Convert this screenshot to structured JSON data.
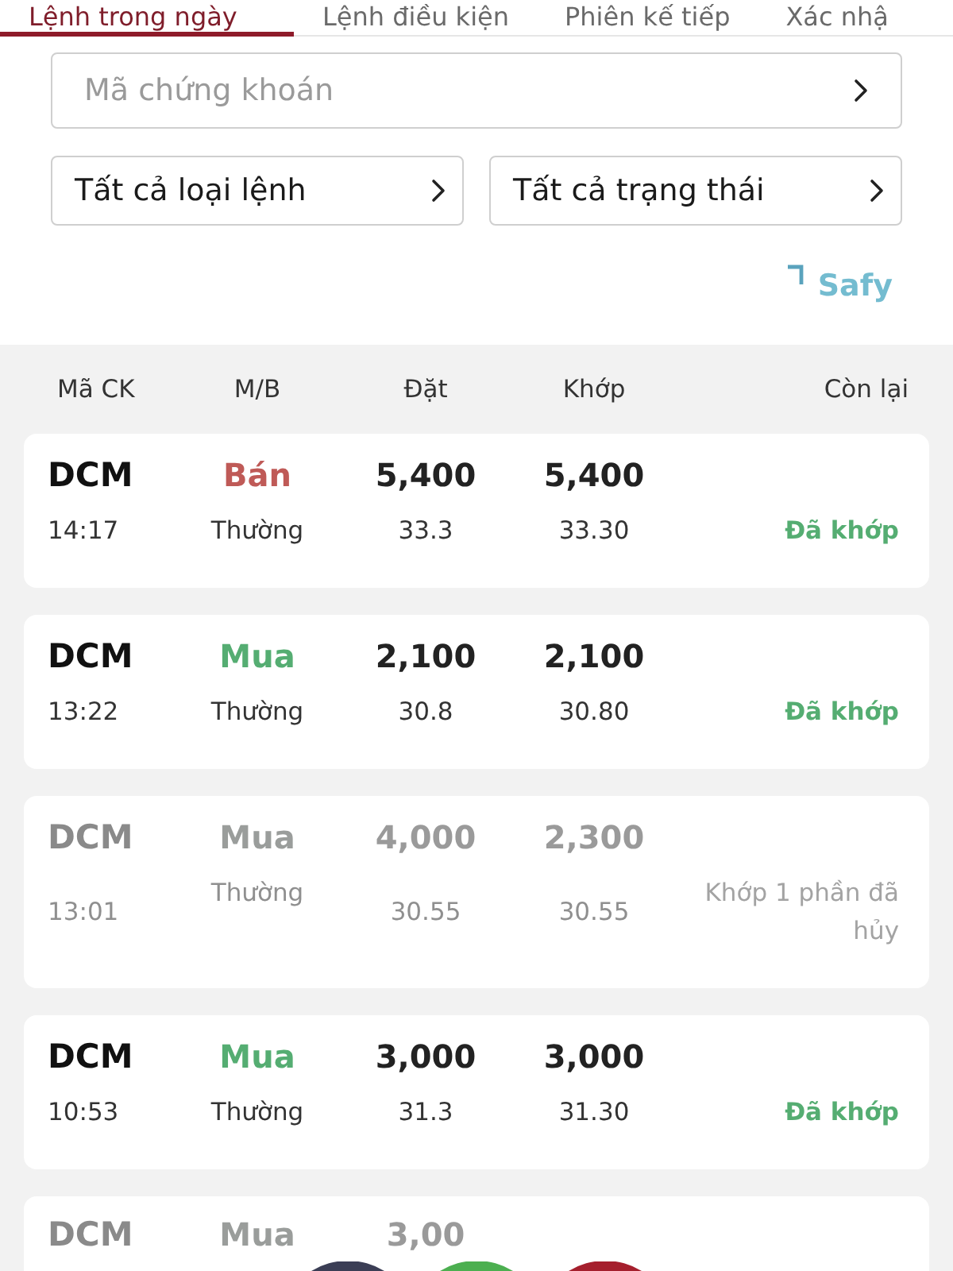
{
  "tabs": [
    {
      "label": "Lệnh trong ngày",
      "selected": true
    },
    {
      "label": "Lệnh điều kiện",
      "selected": false
    },
    {
      "label": "Phiên kế tiếp",
      "selected": false
    },
    {
      "label": "Xác nhậ",
      "selected": false
    }
  ],
  "filters": {
    "symbol": {
      "placeholder": "Mã chứng khoán"
    },
    "dropdowns": [
      {
        "value": "Tất cả loại lệnh"
      },
      {
        "value": "Tất cả trạng thái"
      }
    ]
  },
  "brand": {
    "name": "Safy"
  },
  "table": {
    "columns": [
      "Mã CK",
      "M/B",
      "Đặt",
      "Khớp",
      "Còn lại"
    ],
    "rows": [
      {
        "kind": "sell",
        "symbol": "DCM",
        "side": "Bán",
        "order_qty": "5,400",
        "matched_qty": "5,400",
        "time": "14:17",
        "order_type": "Thường",
        "order_price": "33.3",
        "matched_price": "33.30",
        "status": "Đã khớp",
        "disabled": false
      },
      {
        "kind": "buy",
        "symbol": "DCM",
        "side": "Mua",
        "order_qty": "2,100",
        "matched_qty": "2,100",
        "time": "13:22",
        "order_type": "Thường",
        "order_price": "30.8",
        "matched_price": "30.80",
        "status": "Đã khớp",
        "disabled": false
      },
      {
        "kind": "buy",
        "symbol": "DCM",
        "side": "Mua",
        "order_qty": "4,000",
        "matched_qty": "2,300",
        "time": "13:01",
        "order_type": "Thường",
        "order_price": "30.55",
        "matched_price": "30.55",
        "status": "Khớp 1 phần đã hủy",
        "disabled": true
      },
      {
        "kind": "buy",
        "symbol": "DCM",
        "side": "Mua",
        "order_qty": "3,000",
        "matched_qty": "3,000",
        "time": "10:53",
        "order_type": "Thường",
        "order_price": "31.3",
        "matched_price": "31.30",
        "status": "Đã khớp",
        "disabled": false
      },
      {
        "kind": "buy",
        "symbol": "DCM",
        "side": "Mua",
        "order_qty": "3,00",
        "disabled": true
      }
    ]
  },
  "action_buttons": [
    {
      "color": "#3b3e55"
    },
    {
      "color": "#4caf50"
    },
    {
      "color": "#a51f2d"
    }
  ]
}
